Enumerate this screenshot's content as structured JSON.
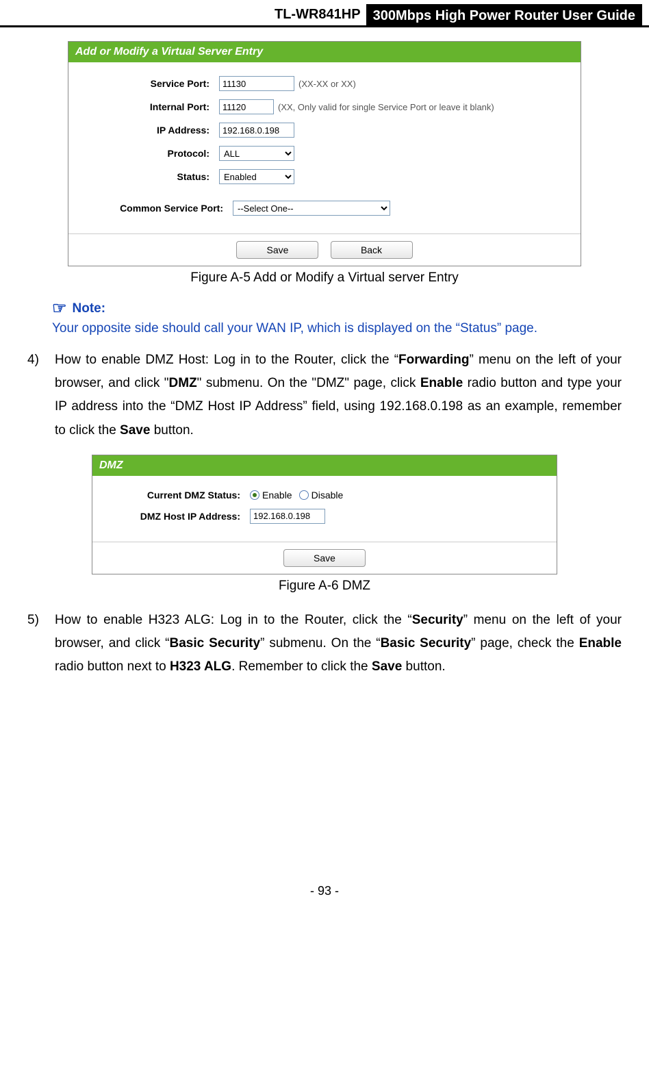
{
  "header": {
    "model": "TL-WR841HP",
    "title": "300Mbps High Power Router User Guide"
  },
  "panelA5": {
    "title": "Add or Modify a Virtual Server Entry",
    "rows": {
      "servicePort": {
        "label": "Service Port:",
        "value": "11130",
        "hint": "(XX-XX or XX)"
      },
      "internalPort": {
        "label": "Internal Port:",
        "value": "11120",
        "hint": "(XX, Only valid for single Service Port or leave it blank)"
      },
      "ipAddress": {
        "label": "IP Address:",
        "value": "192.168.0.198"
      },
      "protocol": {
        "label": "Protocol:",
        "value": "ALL"
      },
      "status": {
        "label": "Status:",
        "value": "Enabled"
      },
      "commonServicePort": {
        "label": "Common Service Port:",
        "value": "--Select One--"
      }
    },
    "buttons": {
      "save": "Save",
      "back": "Back"
    },
    "caption": "Figure A-5    Add or Modify a Virtual server Entry"
  },
  "note": {
    "heading": "Note:",
    "body": "Your opposite side should call your WAN IP, which is displayed on the “Status” page."
  },
  "step4": {
    "num": "4)",
    "t1": "How to enable DMZ Host: Log in to the Router, click the “",
    "b1": "Forwarding",
    "t2": "” menu on the left of your browser, and click \"",
    "b2": "DMZ",
    "t3": "\" submenu. On the \"DMZ\" page, click ",
    "b3": "Enable",
    "t4": " radio button and type your IP address into the “DMZ Host IP Address” field, using 192.168.0.198 as an example, remember to click the ",
    "b4": "Save",
    "t5": " button."
  },
  "panelA6": {
    "title": "DMZ",
    "rows": {
      "status": {
        "label": "Current DMZ Status:",
        "enable": "Enable",
        "disable": "Disable"
      },
      "host": {
        "label": "DMZ Host IP Address:",
        "value": "192.168.0.198"
      }
    },
    "buttons": {
      "save": "Save"
    },
    "caption": "Figure A-6 DMZ"
  },
  "step5": {
    "num": "5)",
    "t1": "How to enable H323 ALG: Log in to the Router, click the “",
    "b1": "Security",
    "t2": "” menu on the left of your browser, and click “",
    "b2": "Basic Security",
    "t3": "” submenu. On the “",
    "b3": "Basic Security",
    "t4": "” page, check the ",
    "b4": "Enable",
    "t5": " radio button next to ",
    "b5": "H323 ALG",
    "t6": ". Remember to click the ",
    "b6": "Save",
    "t7": " button."
  },
  "footer": {
    "pageNum": "- 93 -"
  }
}
